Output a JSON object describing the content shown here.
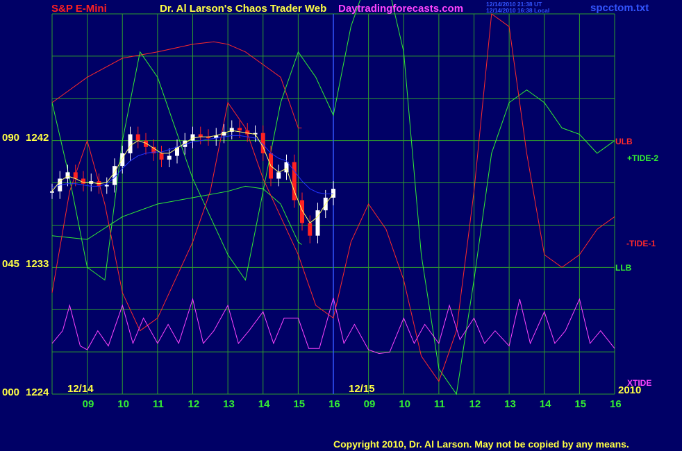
{
  "header": {
    "symbol": "S&P E-Mini",
    "title": "Dr. Al Larson's Chaos Trader Web",
    "site": "Daytradingforecasts.com",
    "time_utc": "12/14/2010 21:38 UT",
    "time_local": "12/14/2010 16:38 Local",
    "filename": "spcctom.txt"
  },
  "footer": {
    "copyright": "Copyright 2010, Dr. Al Larson. May not be copied by any means."
  },
  "colors": {
    "background": "#000066",
    "grid": "#2e9e2e",
    "divider": "#3355ff",
    "price_up": "#ffffff",
    "price_down": "#ff2222",
    "ma_fast": "#ffff66",
    "ma_slow": "#2233ff",
    "red_lines": "#ff2a2a",
    "green_lines": "#33ee33",
    "xtide": "#ff44ff"
  },
  "chart_data": {
    "type": "line",
    "y_axis": {
      "labels": [
        {
          "scale": "090",
          "price": "1242"
        },
        {
          "scale": "045",
          "price": "1233"
        },
        {
          "scale": "000",
          "price": "1224"
        }
      ],
      "range": [
        1221,
        1251
      ]
    },
    "x_axis": {
      "hour_labels": [
        "09",
        "10",
        "11",
        "12",
        "13",
        "14",
        "15",
        "16",
        "09",
        "10",
        "11",
        "12",
        "13",
        "14",
        "15",
        "16"
      ],
      "date_labels": [
        "12/14",
        "12/15"
      ],
      "year_label": "2010"
    },
    "legend": [
      "ULB",
      "+TIDE-2",
      "-TIDE-1",
      "LLB",
      "XTIDE"
    ],
    "series": [
      {
        "name": "ULB",
        "color": "red",
        "x": [
          0,
          0.5,
          1,
          2,
          3,
          4,
          4.6,
          5,
          5.5,
          6,
          6.5,
          7,
          7.1
        ],
        "y": [
          1244,
          1245,
          1246,
          1247.5,
          1248,
          1248.6,
          1248.8,
          1248.6,
          1248,
          1247,
          1246,
          1242,
          1242
        ]
      },
      {
        "name": "LLB",
        "color": "green",
        "x": [
          0,
          1,
          2,
          3,
          4,
          5,
          5.5,
          6,
          6.5,
          7,
          7.1
        ],
        "y": [
          1233.5,
          1233.2,
          1235,
          1236,
          1236.5,
          1237,
          1237.4,
          1237.2,
          1236,
          1233,
          1232.8
        ]
      },
      {
        "name": "+TIDE-2",
        "color": "green",
        "x": [
          0,
          0.5,
          1,
          1.5,
          2,
          2.5,
          3,
          3.5,
          4,
          4.5,
          5,
          5.5,
          6,
          6.5,
          7,
          7.5,
          8,
          8.5,
          9,
          9.5,
          10,
          10.5,
          11,
          11.5,
          12,
          12.5,
          13,
          13.5,
          14,
          14.5,
          15,
          15.5,
          16
        ],
        "y": [
          1244,
          1238,
          1231,
          1230,
          1241,
          1248,
          1246,
          1242,
          1238,
          1235,
          1232,
          1230,
          1237,
          1244,
          1248,
          1246,
          1243,
          1250,
          1254,
          1254,
          1248,
          1232,
          1223,
          1221,
          1230,
          1240,
          1244,
          1245,
          1244,
          1242,
          1241.5,
          1240,
          1241
        ]
      },
      {
        "name": "-TIDE-1",
        "color": "red",
        "x": [
          0,
          0.5,
          1,
          1.5,
          2,
          2.5,
          3,
          3.5,
          4,
          4.5,
          5,
          5.5,
          6,
          6.5,
          7,
          7.5,
          8,
          8.5,
          9,
          9.5,
          10,
          10.5,
          11,
          11.5,
          12,
          12.5,
          13,
          13.5,
          14,
          14.5,
          15,
          15.5,
          16
        ],
        "y": [
          1229,
          1237,
          1241,
          1236,
          1229,
          1226,
          1227,
          1230,
          1233,
          1237,
          1244,
          1242,
          1238,
          1235,
          1232,
          1228,
          1227,
          1233,
          1236,
          1234,
          1230,
          1224,
          1222,
          1226,
          1237,
          1251,
          1250,
          1240,
          1232,
          1231,
          1232,
          1234,
          1235
        ]
      },
      {
        "name": "XTIDE",
        "color": "magenta",
        "x": [
          0,
          0.3,
          0.5,
          0.8,
          1,
          1.3,
          1.6,
          2,
          2.3,
          2.6,
          3,
          3.3,
          3.6,
          4,
          4.3,
          4.6,
          5,
          5.3,
          5.6,
          6,
          6.3,
          6.6,
          7,
          7.3,
          7.6,
          8,
          8.3,
          8.6,
          9,
          9.3,
          9.6,
          10,
          10.3,
          10.6,
          11,
          11.3,
          11.6,
          12,
          12.3,
          12.6,
          13,
          13.3,
          13.6,
          14,
          14.3,
          14.6,
          15,
          15.3,
          15.6,
          16
        ],
        "y": [
          1225,
          1226,
          1228,
          1224.8,
          1224.5,
          1226,
          1224.8,
          1228,
          1225,
          1227,
          1225,
          1226.5,
          1225,
          1228.5,
          1225,
          1226,
          1228,
          1225,
          1226,
          1227.5,
          1225,
          1227,
          1227,
          1224.6,
          1224.6,
          1228.6,
          1225,
          1226.5,
          1224.5,
          1224.2,
          1224.3,
          1227,
          1225,
          1226.5,
          1225,
          1228,
          1225.3,
          1227,
          1225,
          1226,
          1224.8,
          1228.5,
          1225,
          1227.5,
          1225,
          1226,
          1228.5,
          1225,
          1226,
          1224.6
        ]
      }
    ],
    "price_bars": {
      "x_range": [
        0,
        8
      ],
      "close": [
        1237,
        1238,
        1238.5,
        1238,
        1237.6,
        1237.8,
        1237.4,
        1237.5,
        1239,
        1240,
        1241.5,
        1241,
        1240.5,
        1240,
        1239.5,
        1239.8,
        1240.5,
        1241,
        1241.5,
        1241.3,
        1241.2,
        1241.4,
        1241.7,
        1242,
        1241.8,
        1241.5,
        1241.6,
        1240,
        1238,
        1238.5,
        1239.3,
        1236.3,
        1234.5,
        1233.5,
        1235.5,
        1236.5,
        1237.2
      ],
      "ma_fast": [
        1237,
        1237.8,
        1238.2,
        1238,
        1237.7,
        1237.7,
        1237.6,
        1237.7,
        1238.5,
        1239.6,
        1240.6,
        1241,
        1240.8,
        1240.4,
        1240,
        1240,
        1240.4,
        1240.8,
        1241.2,
        1241.3,
        1241.3,
        1241.4,
        1241.6,
        1241.8,
        1241.7,
        1241.6,
        1241.5,
        1240.5,
        1239,
        1238.5,
        1238.8,
        1237,
        1235.5,
        1234.5,
        1235,
        1236,
        1236.8
      ],
      "ma_slow": [
        1237.3,
        1237.5,
        1237.6,
        1237.6,
        1237.5,
        1237.4,
        1237.4,
        1237.6,
        1238.1,
        1238.8,
        1239.4,
        1239.8,
        1240,
        1240.1,
        1240.1,
        1240.3,
        1240.5,
        1240.7,
        1240.9,
        1241,
        1241.1,
        1241.2,
        1241.3,
        1241.4,
        1241.4,
        1241.3,
        1241.2,
        1240.7,
        1240,
        1239.6,
        1239.4,
        1238.6,
        1237.8,
        1237.2,
        1236.9,
        1236.8,
        1236.8
      ]
    }
  }
}
